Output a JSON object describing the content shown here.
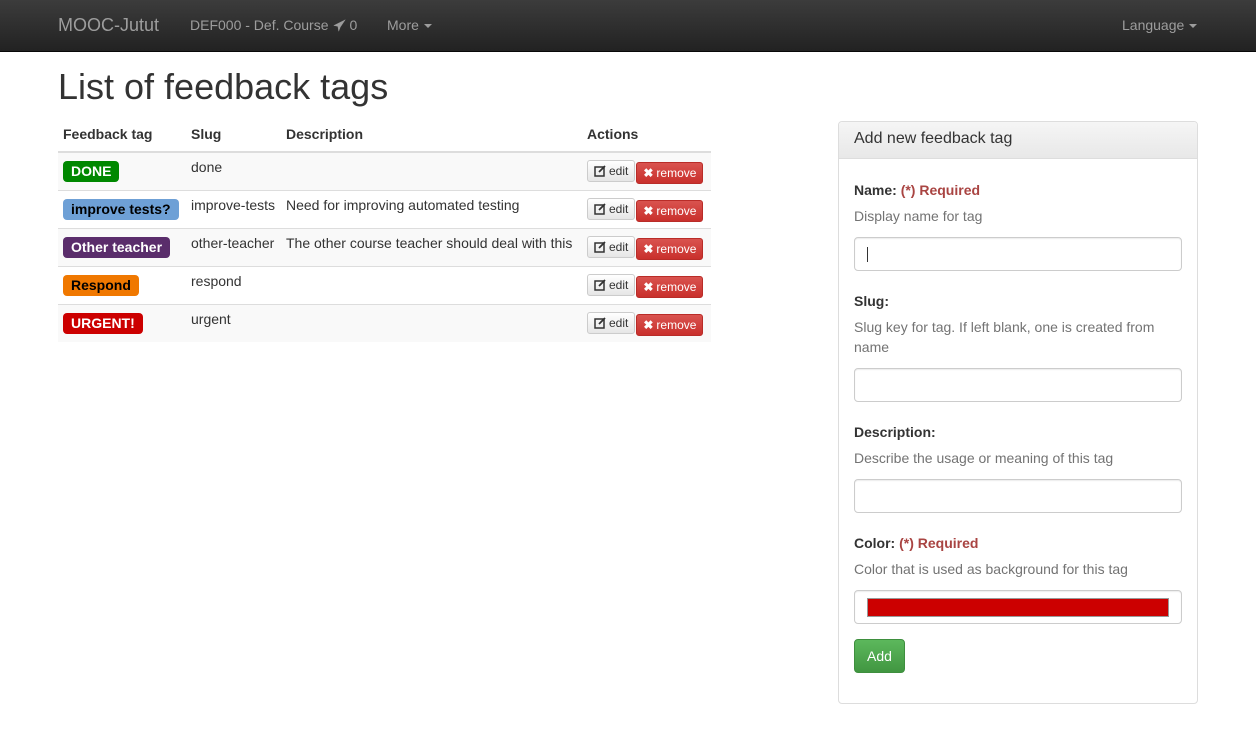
{
  "nav": {
    "brand": "MOOC-Jutut",
    "course": "DEF000 - Def. Course",
    "course_count": "0",
    "more": "More",
    "language": "Language"
  },
  "page_title": "List of feedback tags",
  "table": {
    "headers": [
      "Feedback tag",
      "Slug",
      "Description",
      "Actions"
    ],
    "rows": [
      {
        "tag": "DONE",
        "color": "#008800",
        "text_color": "#ffffff",
        "slug": "done",
        "description": ""
      },
      {
        "tag": "improve tests?",
        "color": "#6ea0d6",
        "text_color": "#000000",
        "slug": "improve-tests",
        "description": "Need for improving automated testing"
      },
      {
        "tag": "Other teacher",
        "color": "#5a2d6b",
        "text_color": "#ffffff",
        "slug": "other-teacher",
        "description": "The other course teacher should deal with this"
      },
      {
        "tag": "Respond",
        "color": "#f07800",
        "text_color": "#000000",
        "slug": "respond",
        "description": ""
      },
      {
        "tag": "URGENT!",
        "color": "#cc0000",
        "text_color": "#ffffff",
        "slug": "urgent",
        "description": ""
      }
    ],
    "edit_label": "edit",
    "remove_label": "remove"
  },
  "form": {
    "title": "Add new feedback tag",
    "name_label": "Name:",
    "required": "(*) Required",
    "name_help": "Display name for tag",
    "slug_label": "Slug:",
    "slug_help": "Slug key for tag. If left blank, one is created from name",
    "description_label": "Description:",
    "description_help": "Describe the usage or meaning of this tag",
    "color_label": "Color:",
    "color_help": "Color that is used as background for this tag",
    "color_value": "#cc0000",
    "add_label": "Add"
  }
}
